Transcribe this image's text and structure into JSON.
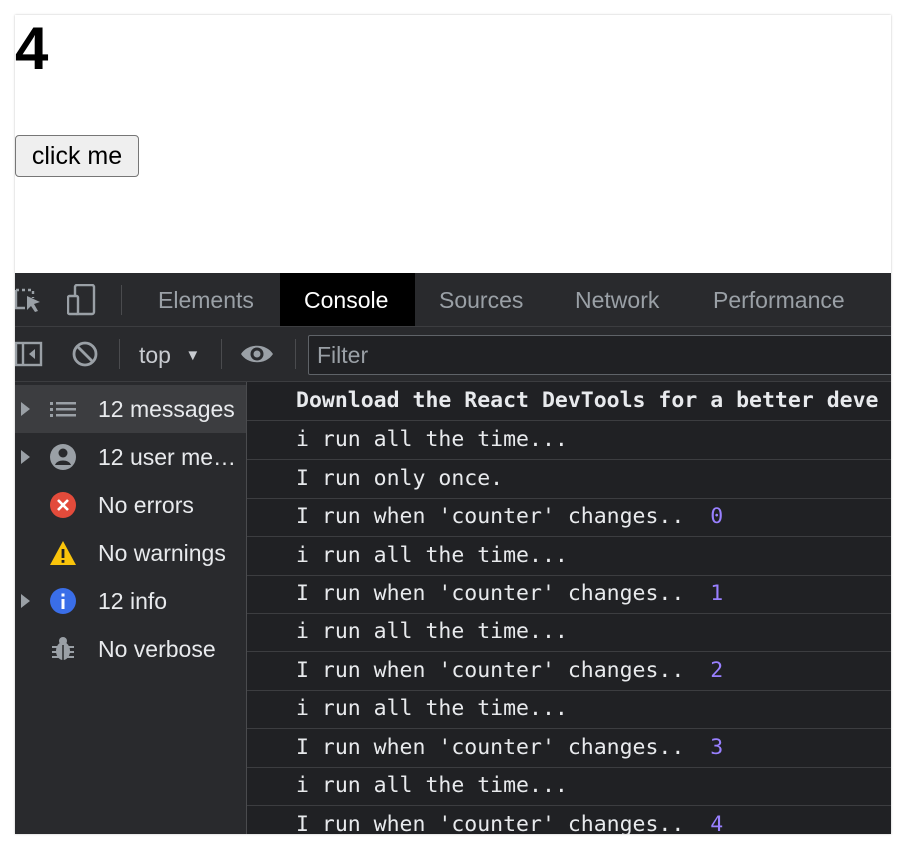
{
  "app": {
    "counter_value": "4",
    "button_label": "click me"
  },
  "devtools": {
    "tabs": [
      {
        "label": "Elements",
        "active": false
      },
      {
        "label": "Console",
        "active": true
      },
      {
        "label": "Sources",
        "active": false
      },
      {
        "label": "Network",
        "active": false
      },
      {
        "label": "Performance",
        "active": false
      }
    ],
    "toolbar": {
      "context": "top",
      "filter_placeholder": "Filter"
    },
    "sidebar": [
      {
        "label": "12 messages",
        "icon": "list-icon",
        "expandable": true,
        "selected": true
      },
      {
        "label": "12 user me…",
        "icon": "user-icon",
        "expandable": true,
        "selected": false
      },
      {
        "label": "No errors",
        "icon": "error-icon",
        "expandable": false,
        "selected": false
      },
      {
        "label": "No warnings",
        "icon": "warning-icon",
        "expandable": false,
        "selected": false
      },
      {
        "label": "12 info",
        "icon": "info-icon",
        "expandable": true,
        "selected": false
      },
      {
        "label": "No verbose",
        "icon": "bug-icon",
        "expandable": false,
        "selected": false
      }
    ],
    "messages": [
      {
        "text": "Download the React DevTools for a better deve",
        "bold": true
      },
      {
        "text": "i run all the time..."
      },
      {
        "text": "I run only once."
      },
      {
        "text": "I run when 'counter' changes..",
        "value": "0"
      },
      {
        "text": "i run all the time..."
      },
      {
        "text": "I run when 'counter' changes..",
        "value": "1"
      },
      {
        "text": "i run all the time..."
      },
      {
        "text": "I run when 'counter' changes..",
        "value": "2"
      },
      {
        "text": "i run all the time..."
      },
      {
        "text": "I run when 'counter' changes..",
        "value": "3"
      },
      {
        "text": "i run all the time..."
      },
      {
        "text": "I run when 'counter' changes..",
        "value": "4"
      }
    ],
    "colors": {
      "panel_bg": "#202124",
      "toolbar_bg": "#292a2d",
      "number_color": "#9980ff",
      "error_red": "#e34b3b",
      "warning_yellow": "#f9c40b",
      "info_blue": "#3a6ee8"
    }
  }
}
